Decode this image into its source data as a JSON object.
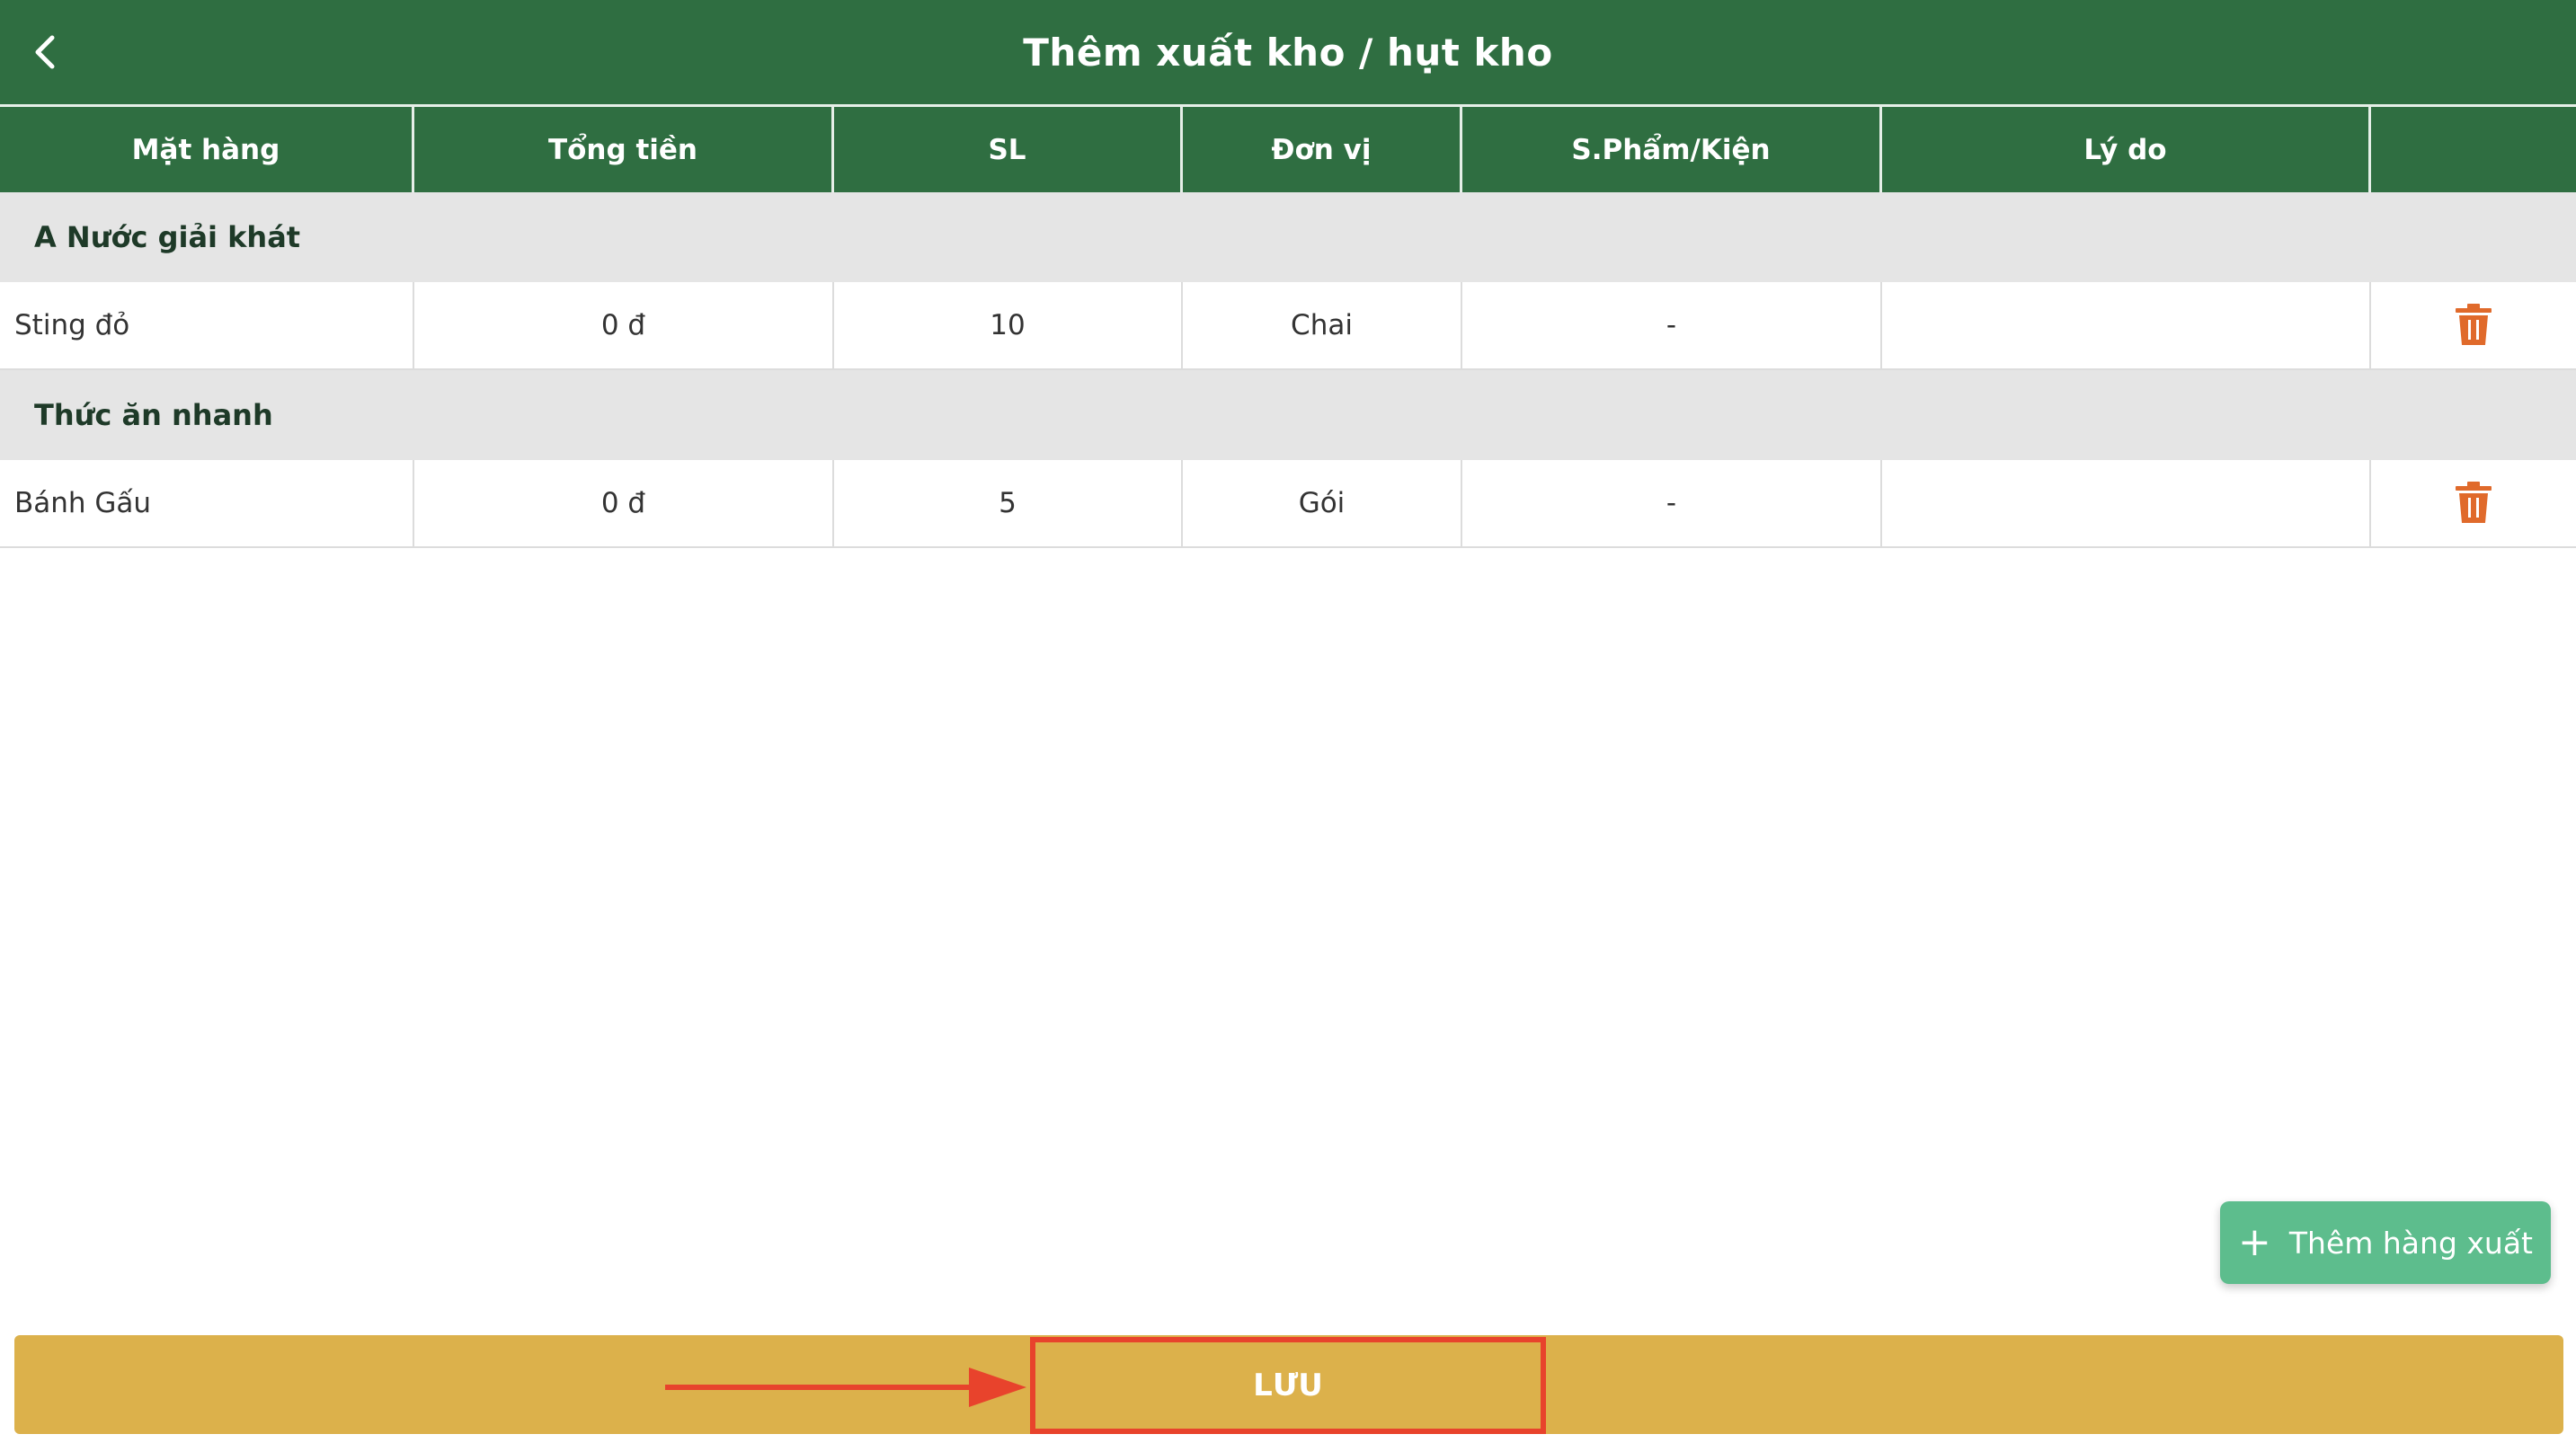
{
  "header": {
    "title": "Thêm xuất kho / hụt kho",
    "back_icon": "chevron-left-icon"
  },
  "table": {
    "columns": [
      "Mặt hàng",
      "Tổng tiền",
      "SL",
      "Đơn vị",
      "S.Phẩm/Kiện",
      "Lý do",
      ""
    ],
    "groups": [
      {
        "name": "A Nước giải khát",
        "rows": [
          {
            "item": "Sting đỏ",
            "total": "0 đ",
            "qty": "10",
            "unit": "Chai",
            "per_pack": "-",
            "reason": ""
          }
        ]
      },
      {
        "name": "Thức ăn nhanh",
        "rows": [
          {
            "item": "Bánh Gấu",
            "total": "0 đ",
            "qty": "5",
            "unit": "Gói",
            "per_pack": "-",
            "reason": ""
          }
        ]
      }
    ],
    "delete_icon": "trash-icon"
  },
  "add_button": {
    "label": "Thêm hàng xuất",
    "icon": "plus-icon"
  },
  "save_button": {
    "label": "LƯU"
  },
  "colors": {
    "header_bg": "#2f6e41",
    "group_bg": "#e5e5e5",
    "delete_icon": "#e06a2b",
    "add_button_bg": "#5dbd8d",
    "footer_bg": "#dcb14b",
    "highlight": "#e8432c"
  }
}
